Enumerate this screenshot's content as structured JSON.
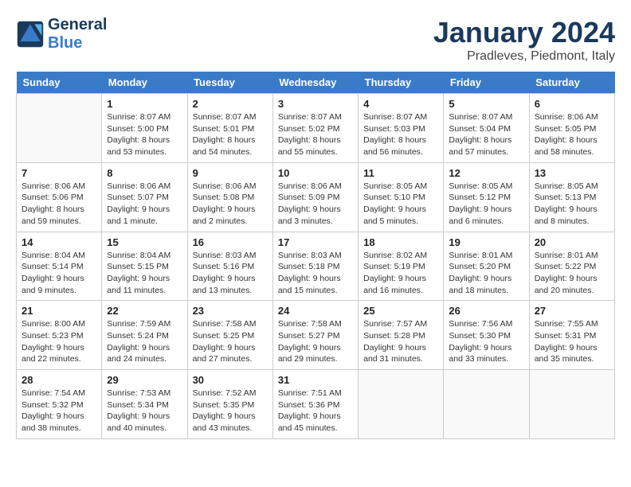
{
  "logo": {
    "line1": "General",
    "line2": "Blue"
  },
  "title": "January 2024",
  "subtitle": "Pradleves, Piedmont, Italy",
  "days_of_week": [
    "Sunday",
    "Monday",
    "Tuesday",
    "Wednesday",
    "Thursday",
    "Friday",
    "Saturday"
  ],
  "weeks": [
    [
      {
        "day": "",
        "detail": ""
      },
      {
        "day": "1",
        "detail": "Sunrise: 8:07 AM\nSunset: 5:00 PM\nDaylight: 8 hours\nand 53 minutes."
      },
      {
        "day": "2",
        "detail": "Sunrise: 8:07 AM\nSunset: 5:01 PM\nDaylight: 8 hours\nand 54 minutes."
      },
      {
        "day": "3",
        "detail": "Sunrise: 8:07 AM\nSunset: 5:02 PM\nDaylight: 8 hours\nand 55 minutes."
      },
      {
        "day": "4",
        "detail": "Sunrise: 8:07 AM\nSunset: 5:03 PM\nDaylight: 8 hours\nand 56 minutes."
      },
      {
        "day": "5",
        "detail": "Sunrise: 8:07 AM\nSunset: 5:04 PM\nDaylight: 8 hours\nand 57 minutes."
      },
      {
        "day": "6",
        "detail": "Sunrise: 8:06 AM\nSunset: 5:05 PM\nDaylight: 8 hours\nand 58 minutes."
      }
    ],
    [
      {
        "day": "7",
        "detail": "Sunrise: 8:06 AM\nSunset: 5:06 PM\nDaylight: 8 hours\nand 59 minutes."
      },
      {
        "day": "8",
        "detail": "Sunrise: 8:06 AM\nSunset: 5:07 PM\nDaylight: 9 hours\nand 1 minute."
      },
      {
        "day": "9",
        "detail": "Sunrise: 8:06 AM\nSunset: 5:08 PM\nDaylight: 9 hours\nand 2 minutes."
      },
      {
        "day": "10",
        "detail": "Sunrise: 8:06 AM\nSunset: 5:09 PM\nDaylight: 9 hours\nand 3 minutes."
      },
      {
        "day": "11",
        "detail": "Sunrise: 8:05 AM\nSunset: 5:10 PM\nDaylight: 9 hours\nand 5 minutes."
      },
      {
        "day": "12",
        "detail": "Sunrise: 8:05 AM\nSunset: 5:12 PM\nDaylight: 9 hours\nand 6 minutes."
      },
      {
        "day": "13",
        "detail": "Sunrise: 8:05 AM\nSunset: 5:13 PM\nDaylight: 9 hours\nand 8 minutes."
      }
    ],
    [
      {
        "day": "14",
        "detail": "Sunrise: 8:04 AM\nSunset: 5:14 PM\nDaylight: 9 hours\nand 9 minutes."
      },
      {
        "day": "15",
        "detail": "Sunrise: 8:04 AM\nSunset: 5:15 PM\nDaylight: 9 hours\nand 11 minutes."
      },
      {
        "day": "16",
        "detail": "Sunrise: 8:03 AM\nSunset: 5:16 PM\nDaylight: 9 hours\nand 13 minutes."
      },
      {
        "day": "17",
        "detail": "Sunrise: 8:03 AM\nSunset: 5:18 PM\nDaylight: 9 hours\nand 15 minutes."
      },
      {
        "day": "18",
        "detail": "Sunrise: 8:02 AM\nSunset: 5:19 PM\nDaylight: 9 hours\nand 16 minutes."
      },
      {
        "day": "19",
        "detail": "Sunrise: 8:01 AM\nSunset: 5:20 PM\nDaylight: 9 hours\nand 18 minutes."
      },
      {
        "day": "20",
        "detail": "Sunrise: 8:01 AM\nSunset: 5:22 PM\nDaylight: 9 hours\nand 20 minutes."
      }
    ],
    [
      {
        "day": "21",
        "detail": "Sunrise: 8:00 AM\nSunset: 5:23 PM\nDaylight: 9 hours\nand 22 minutes."
      },
      {
        "day": "22",
        "detail": "Sunrise: 7:59 AM\nSunset: 5:24 PM\nDaylight: 9 hours\nand 24 minutes."
      },
      {
        "day": "23",
        "detail": "Sunrise: 7:58 AM\nSunset: 5:25 PM\nDaylight: 9 hours\nand 27 minutes."
      },
      {
        "day": "24",
        "detail": "Sunrise: 7:58 AM\nSunset: 5:27 PM\nDaylight: 9 hours\nand 29 minutes."
      },
      {
        "day": "25",
        "detail": "Sunrise: 7:57 AM\nSunset: 5:28 PM\nDaylight: 9 hours\nand 31 minutes."
      },
      {
        "day": "26",
        "detail": "Sunrise: 7:56 AM\nSunset: 5:30 PM\nDaylight: 9 hours\nand 33 minutes."
      },
      {
        "day": "27",
        "detail": "Sunrise: 7:55 AM\nSunset: 5:31 PM\nDaylight: 9 hours\nand 35 minutes."
      }
    ],
    [
      {
        "day": "28",
        "detail": "Sunrise: 7:54 AM\nSunset: 5:32 PM\nDaylight: 9 hours\nand 38 minutes."
      },
      {
        "day": "29",
        "detail": "Sunrise: 7:53 AM\nSunset: 5:34 PM\nDaylight: 9 hours\nand 40 minutes."
      },
      {
        "day": "30",
        "detail": "Sunrise: 7:52 AM\nSunset: 5:35 PM\nDaylight: 9 hours\nand 43 minutes."
      },
      {
        "day": "31",
        "detail": "Sunrise: 7:51 AM\nSunset: 5:36 PM\nDaylight: 9 hours\nand 45 minutes."
      },
      {
        "day": "",
        "detail": ""
      },
      {
        "day": "",
        "detail": ""
      },
      {
        "day": "",
        "detail": ""
      }
    ]
  ]
}
